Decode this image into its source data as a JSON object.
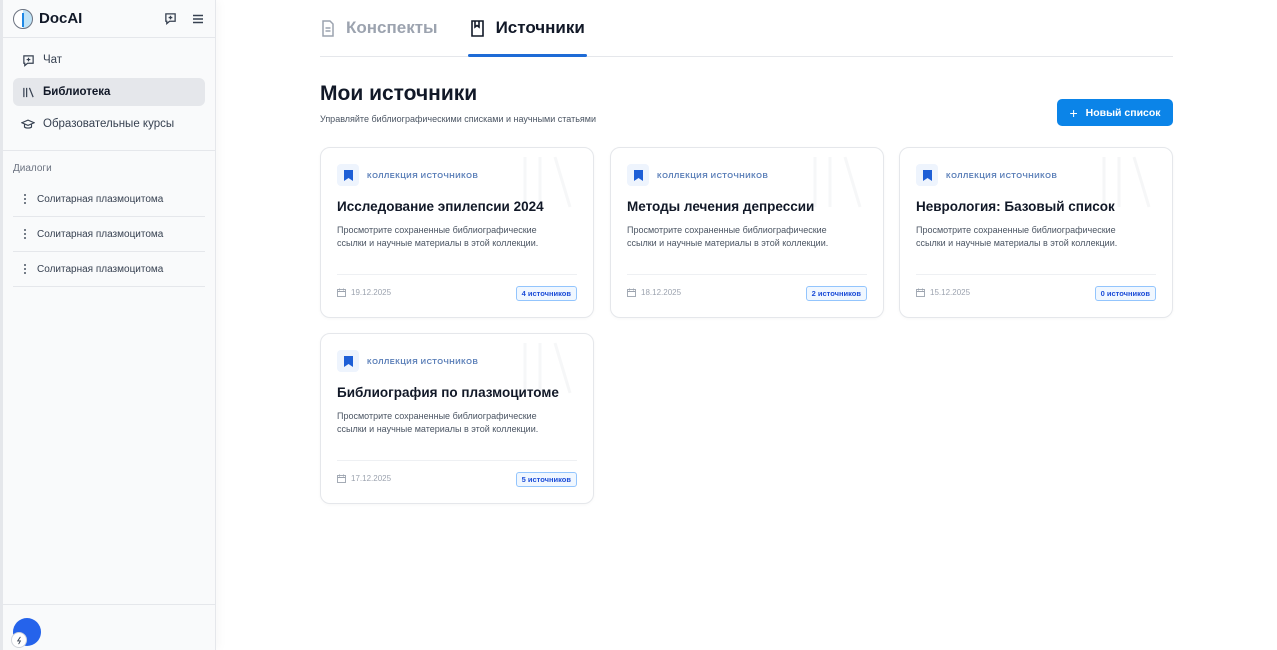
{
  "sidebar": {
    "brand": "DocAI",
    "nav": [
      {
        "label": "Чат",
        "icon": "new-chat-icon"
      },
      {
        "label": "Библиотека",
        "icon": "library-icon",
        "active": true
      },
      {
        "label": "Образовательные курсы",
        "icon": "graduation-cap-icon"
      }
    ],
    "section_title": "Диалоги",
    "dialogs": [
      {
        "label": "Солитарная плазмоцитома"
      },
      {
        "label": "Солитарная плазмоцитома"
      },
      {
        "label": "Солитарная плазмоцитома"
      }
    ]
  },
  "tabs": [
    {
      "label": "Конспекты",
      "icon": "document-icon",
      "active": false
    },
    {
      "label": "Источники",
      "icon": "book-icon",
      "active": true
    }
  ],
  "page": {
    "title": "Мои источники",
    "subtitle": "Управляйте библиографическими списками и научными статьями",
    "new_button": "Новый список"
  },
  "cards": [
    {
      "tag": "КОЛЛЕКЦИЯ ИСТОЧНИКОВ",
      "title": "Исследование эпилепсии 2024",
      "description": "Просмотрите сохраненные библиографические ссылки и научные материалы в этой коллекции.",
      "date": "19.12.2025",
      "badge": "4 источников"
    },
    {
      "tag": "КОЛЛЕКЦИЯ ИСТОЧНИКОВ",
      "title": "Методы лечения депрессии",
      "description": "Просмотрите сохраненные библиографические ссылки и научные материалы в этой коллекции.",
      "date": "18.12.2025",
      "badge": "2 источников"
    },
    {
      "tag": "КОЛЛЕКЦИЯ ИСТОЧНИКОВ",
      "title": "Неврология: Базовый список",
      "description": "Просмотрите сохраненные библиографические ссылки и научные материалы в этой коллекции.",
      "date": "15.12.2025",
      "badge": "0 источников"
    },
    {
      "tag": "КОЛЛЕКЦИЯ ИСТОЧНИКОВ",
      "title": "Библиография по плазмоцитоме",
      "description": "Просмотрите сохраненные библиографические ссылки и научные материалы в этой коллекции.",
      "date": "17.12.2025",
      "badge": "5 источников"
    }
  ],
  "colors": {
    "accent": "#0b84e8",
    "tab_underline": "#1e6bd6",
    "badge": "#1d4ed8"
  }
}
